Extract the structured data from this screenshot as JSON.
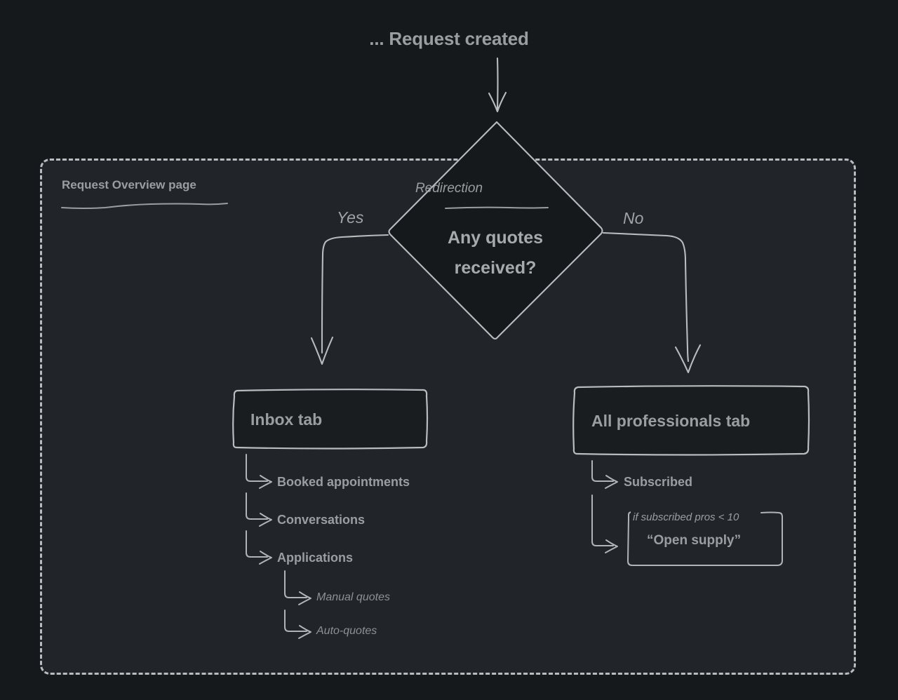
{
  "diagram": {
    "title": "... Request created",
    "background_color": "#16191c",
    "panel_color": "#212529",
    "stroke_color": "#b9bcbe",
    "text_color": "#9a9ea1"
  },
  "group": {
    "label": "Request Overview page"
  },
  "decision": {
    "kind": "Redirection",
    "question_line1": "Any quotes",
    "question_line2": "received?",
    "branches": [
      {
        "label": "Yes",
        "target": "Inbox tab"
      },
      {
        "label": "No",
        "target": "All professionals tab"
      }
    ]
  },
  "branch_labels": {
    "yes": "Yes",
    "no": "No"
  },
  "left_branch": {
    "tab": "Inbox tab",
    "children": [
      {
        "label": "Booked appointments"
      },
      {
        "label": "Conversations"
      },
      {
        "label": "Applications",
        "children": [
          {
            "label": "Manual quotes"
          },
          {
            "label": "Auto-quotes"
          }
        ]
      }
    ]
  },
  "right_branch": {
    "tab": "All professionals tab",
    "children": [
      {
        "label": "Subscribed"
      },
      {
        "label": "“Open supply”",
        "condition": "if subscribed pros < 10"
      }
    ]
  }
}
